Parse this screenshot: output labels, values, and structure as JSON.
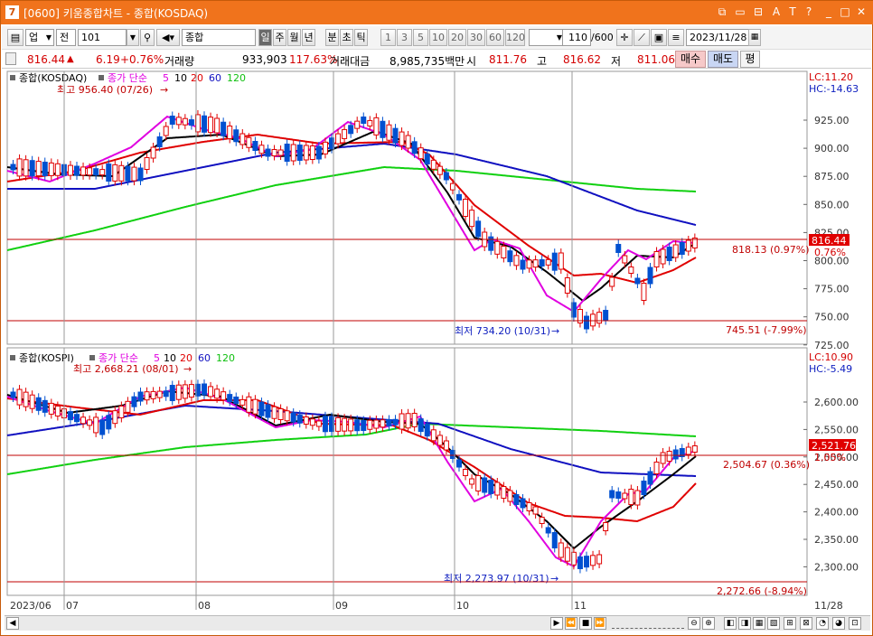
{
  "window": {
    "title": "[0600] 키움종합차트 - 종합(KOSDAQ)",
    "app_icon": "7"
  },
  "toolbar": {
    "market": "업",
    "market_kind": "전",
    "code": "101",
    "name": "종합(KOSDAQ)",
    "period_buttons": [
      "일",
      "주",
      "월",
      "년",
      "분",
      "초",
      "틱"
    ],
    "active_period": "일",
    "intervals": [
      "1",
      "3",
      "5",
      "10",
      "20",
      "30",
      "60",
      "120"
    ],
    "count": "110",
    "count_max": "/600",
    "date": "2023/11/28"
  },
  "quote": {
    "price": "816.44",
    "direction_icon": "up-triangle",
    "change": "6.19",
    "change_pct": "+0.76%",
    "volume_label": "거래량",
    "volume": "933,903",
    "volume_pct": "117.63%",
    "amount_label": "거래대금",
    "amount": "8,985,735백만",
    "open_label": "시",
    "open": "811.76",
    "high_label": "고",
    "high": "816.62",
    "low_label": "저",
    "low": "811.06",
    "buy_label": "매수",
    "sell_label": "매도",
    "eval_label": "평"
  },
  "upper_panel": {
    "legend_name": "종합(KOSDAQ)",
    "legend_ma_label": "종가 단순",
    "ma_periods": [
      "5",
      "10",
      "20",
      "60",
      "120"
    ],
    "high_note": "최고 956.40 (07/26)",
    "low_note": "최저 734.20 (10/31)",
    "lc": "LC:11.20",
    "hc": "HC:-14.63",
    "current_price_tag": "816.44",
    "current_pct_tag": "0.76%",
    "line1_label": "818.13 (0.97%)",
    "line2_label": "745.51 (-7.99%)",
    "y_ticks": [
      "925.00",
      "900.00",
      "875.00",
      "850.00",
      "825.00",
      "800.00",
      "775.00",
      "750.00",
      "725.00"
    ]
  },
  "lower_panel": {
    "legend_name": "종합(KOSPI)",
    "legend_ma_label": "종가 단순",
    "ma_periods": [
      "5",
      "10",
      "20",
      "60",
      "120"
    ],
    "high_note": "최고 2,668.21 (08/01)",
    "low_note": "최저 2,273.97 (10/31)",
    "lc": "LC:10.90",
    "hc": "HC:-5.49",
    "current_price_tag": "2,521.76",
    "current_pct_tag": "1.05%",
    "line1_label": "2,504.67 (0.36%)",
    "line2_label": "2,272.66 (-8.94%)",
    "y_ticks": [
      "2,600.00",
      "2,550.00",
      "2,500.00",
      "2,450.00",
      "2,400.00",
      "2,350.00",
      "2,300.00"
    ]
  },
  "x_axis": {
    "labels": [
      "2023/06",
      "07",
      "08",
      "09",
      "10",
      "11"
    ],
    "end_label": "11/28"
  },
  "colors": {
    "titlebar": "#f0731c",
    "up_candle": "#e00000",
    "down_candle": "#0050d0",
    "ma5": "#e000e0",
    "ma10": "#000000",
    "ma20": "#e00000",
    "ma60": "#1010c0",
    "ma120": "#10d010",
    "price_tag": "#e00000"
  }
}
